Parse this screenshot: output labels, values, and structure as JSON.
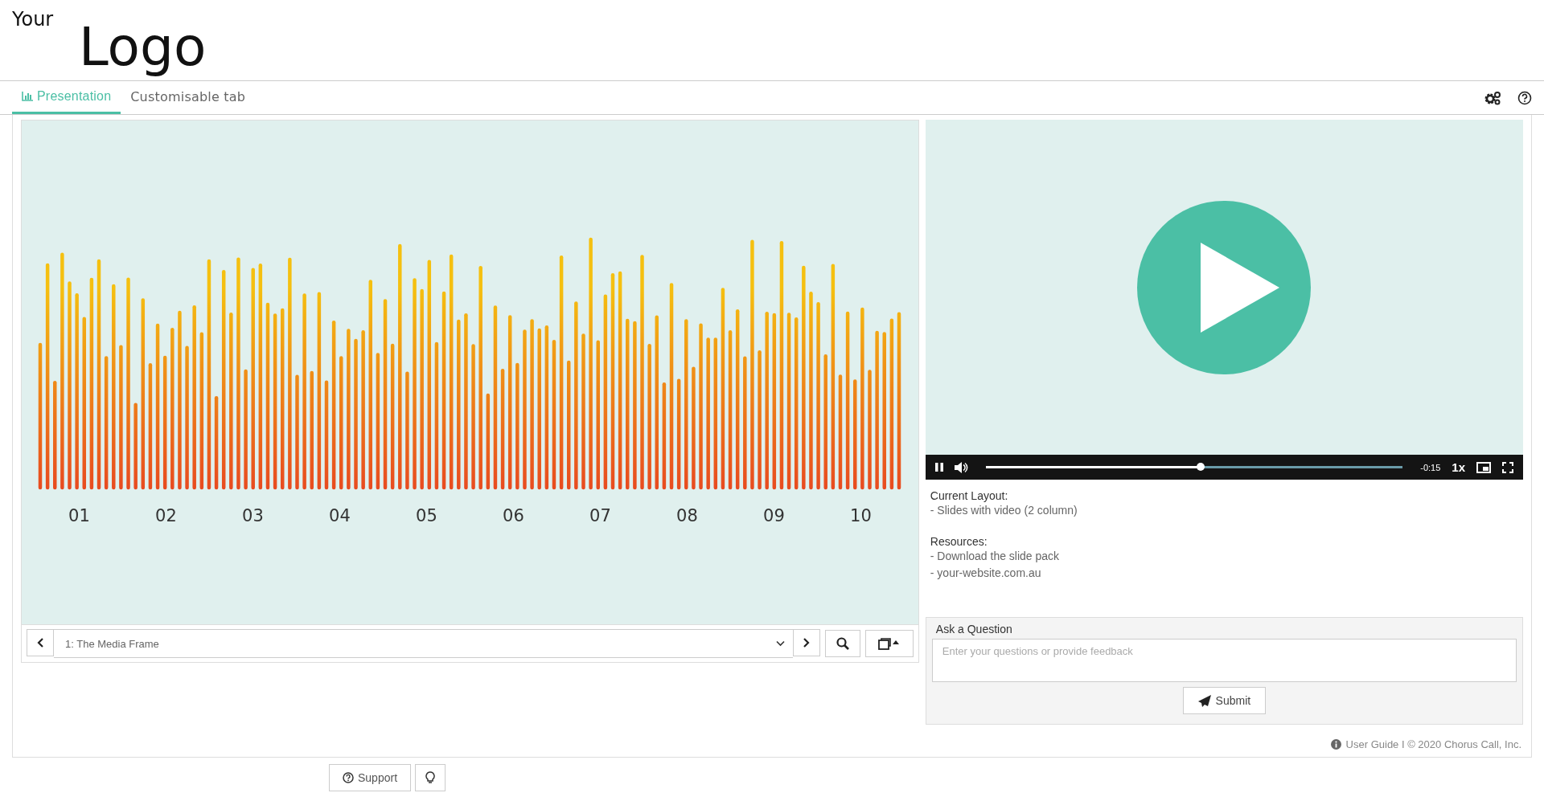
{
  "logo": {
    "small": "Your",
    "large": "Logo"
  },
  "tabs": [
    {
      "label": "Presentation",
      "selected": true
    },
    {
      "label": "Customisable tab",
      "selected": false
    }
  ],
  "slide": {
    "labels": [
      "01",
      "02",
      "03",
      "04",
      "05",
      "06",
      "07",
      "08",
      "09",
      "10"
    ]
  },
  "slide_nav": {
    "current": "1: The Media Frame"
  },
  "video": {
    "playing": true,
    "time": "-0:15",
    "speed": "1x",
    "progress": {
      "level": 0.515
    }
  },
  "info": [
    {
      "heading": "Current Layout:",
      "lines": [
        "- Slides with video (2 column)"
      ]
    },
    {
      "heading": "Resources:",
      "lines": [
        "- Download the slide pack",
        "- your-website.com.au"
      ]
    }
  ],
  "question": {
    "title": "Ask a Question",
    "placeholder": "Enter your questions or provide feedback",
    "submit": "Submit"
  },
  "footer": "User Guide I © 2020 Chorus Call, Inc.",
  "bottom_bar": {
    "support": "Support"
  }
}
